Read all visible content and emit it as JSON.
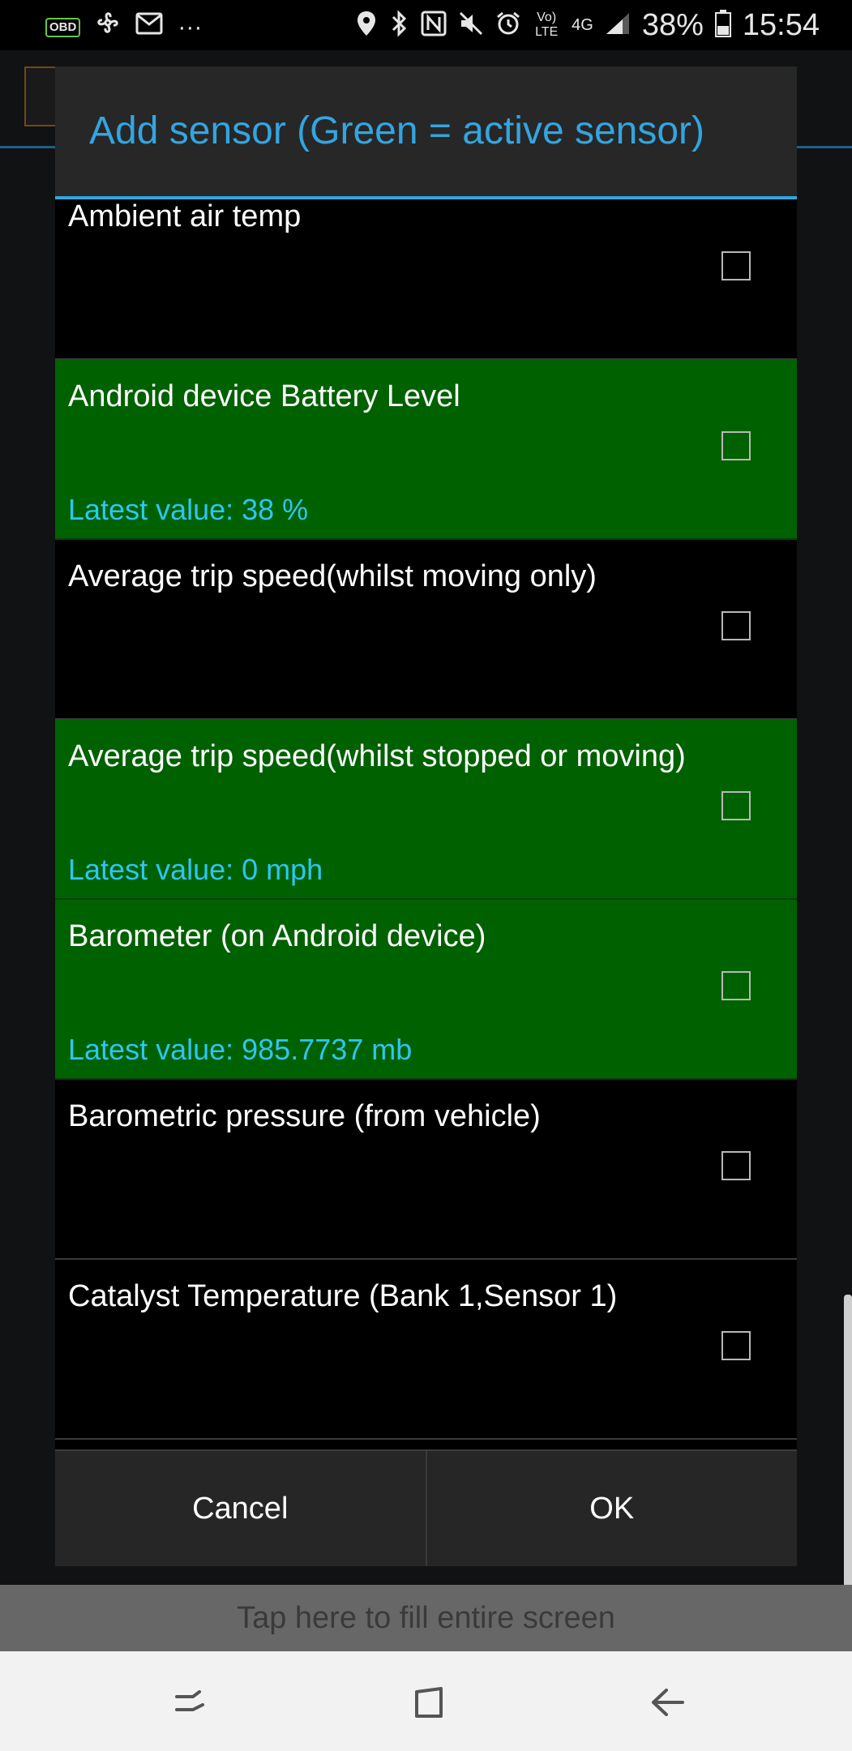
{
  "status_bar": {
    "left_icons": [
      "obd-icon",
      "fan-icon",
      "mail-icon",
      "more-dots-icon"
    ],
    "obd_label": "OBD",
    "more_label": "···",
    "right_icons": [
      "location-icon",
      "bluetooth-icon",
      "nfc-icon",
      "mute-icon",
      "alarm-icon",
      "volte-icon",
      "4g-icon",
      "signal-icon",
      "battery-icon"
    ],
    "volte_label": "Vo) LTE",
    "network_label": "4G",
    "battery_percent": "38%",
    "time": "15:54"
  },
  "dialog": {
    "title": "Add sensor (Green  = active sensor)",
    "colors": {
      "accent": "#33a5e0",
      "active_row": "#006100",
      "value_text": "#2ec5f2"
    },
    "sensors": [
      {
        "name": "Ambient air temp",
        "active": false,
        "value": "",
        "checked": false
      },
      {
        "name": "Android device Battery Level",
        "active": true,
        "value": "Latest value: 38 %",
        "checked": false
      },
      {
        "name": "Average trip speed(whilst moving only)",
        "active": false,
        "value": "",
        "checked": false
      },
      {
        "name": "Average trip speed(whilst stopped or moving)",
        "active": true,
        "value": "Latest value: 0 mph",
        "checked": false
      },
      {
        "name": "Barometer (on Android device)",
        "active": true,
        "value": "Latest value: 985.7737 mb",
        "checked": false
      },
      {
        "name": "Barometric pressure (from vehicle)",
        "active": false,
        "value": "",
        "checked": false
      },
      {
        "name": "Catalyst Temperature (Bank 1,Sensor 1)",
        "active": false,
        "value": "",
        "checked": false
      }
    ],
    "cancel_label": "Cancel",
    "ok_label": "OK"
  },
  "tap_bar": {
    "label": "Tap here to fill entire screen"
  },
  "nav_bar": {
    "icons": [
      "recents-icon",
      "home-icon",
      "back-icon"
    ]
  }
}
